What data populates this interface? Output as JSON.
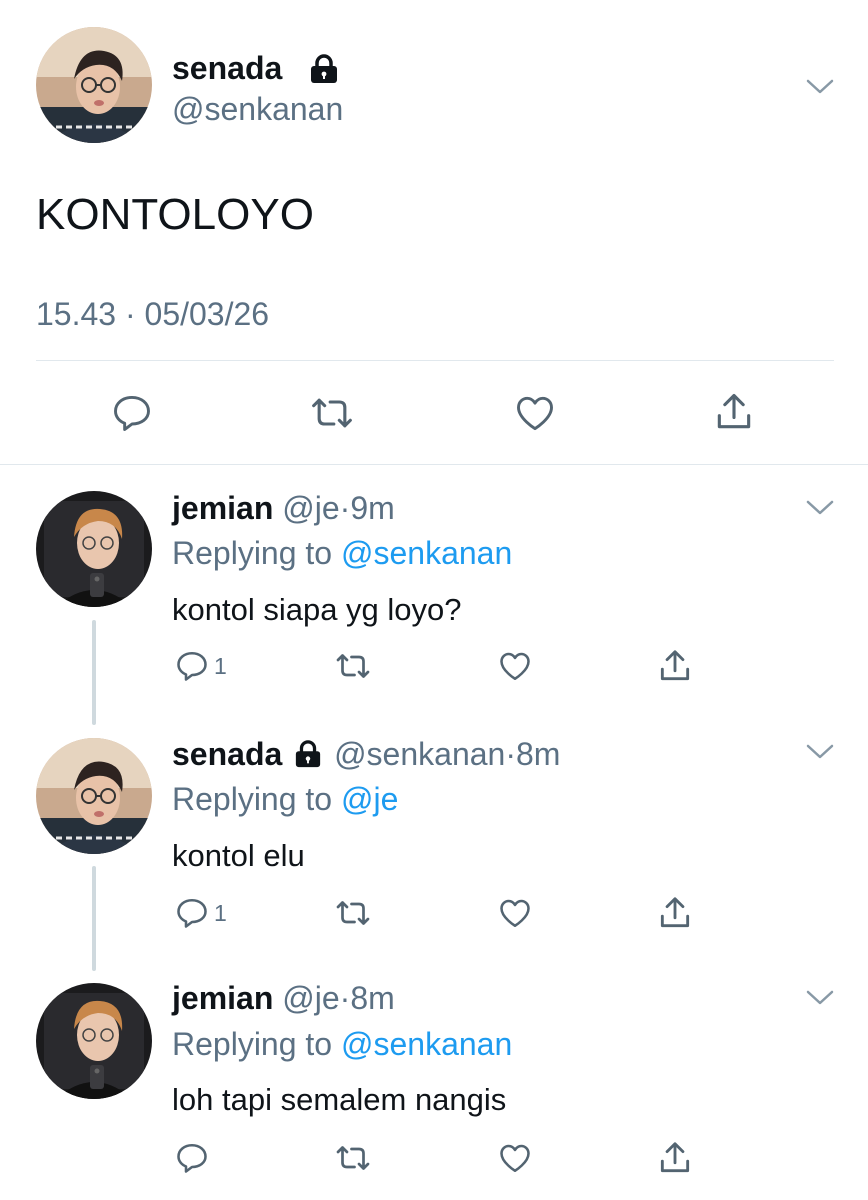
{
  "main_tweet": {
    "display_name": "senada",
    "handle": "@senkanan",
    "text": "KONTOLOYO",
    "time": "15.43",
    "separator": "·",
    "date": "05/03/26"
  },
  "replies": [
    {
      "display_name": "jemian",
      "handle": "@je",
      "separator": "·",
      "time": "9m",
      "replying_prefix": "Replying to",
      "replying_to": "@senkanan",
      "text": "kontol siapa yg loyo?",
      "reply_count": "1"
    },
    {
      "display_name": "senada",
      "handle": "@senkanan",
      "separator": "·",
      "time": "8m",
      "replying_prefix": "Replying to",
      "replying_to": "@je",
      "text": "kontol elu",
      "reply_count": "1"
    },
    {
      "display_name": "jemian",
      "handle": "@je",
      "separator": "·",
      "time": "8m",
      "replying_prefix": "Replying to",
      "replying_to": "@senkanan",
      "text": "loh tapi semalem nangis",
      "reply_count": ""
    }
  ],
  "icons": {
    "reply": "reply-icon",
    "retweet": "retweet-icon",
    "like": "like-icon",
    "share": "share-icon",
    "lock": "lock-icon",
    "more": "chevron-down-icon"
  },
  "colors": {
    "link": "#1d9bf0",
    "muted": "#5b7083",
    "icon": "#536471",
    "divider": "#e1e8ed",
    "thread_line": "#cfd9de"
  }
}
